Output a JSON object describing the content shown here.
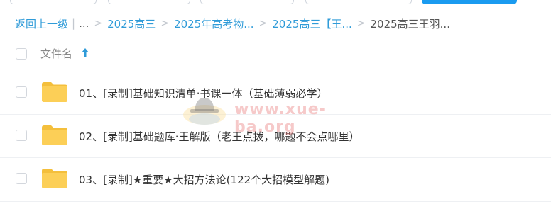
{
  "breadcrumb": {
    "back_label": "返回上一级",
    "divider": "|",
    "ellipsis": "...",
    "items": [
      "2025高三",
      "2025年高考物...",
      "2025高三【王...",
      "2025高三王羽..."
    ]
  },
  "header": {
    "name_column": "文件名",
    "sort_direction": "ascending"
  },
  "files": [
    {
      "name": "01、[录制]基础知识清单·书课一体（基础薄弱必学）",
      "type": "folder"
    },
    {
      "name": "02、[录制]基础题库·王解版（老王点拨，哪题不会点哪里）",
      "type": "folder"
    },
    {
      "name": "03、[录制]★重要★大招方法论(122个大招模型解题)",
      "type": "folder"
    }
  ],
  "watermark": {
    "text": "www.xue-ba.org"
  },
  "colors": {
    "link": "#2f9bd8",
    "primary_button": "#1a9bf0",
    "folder": "#fccf57",
    "folder_tab": "#f4bf3c"
  }
}
